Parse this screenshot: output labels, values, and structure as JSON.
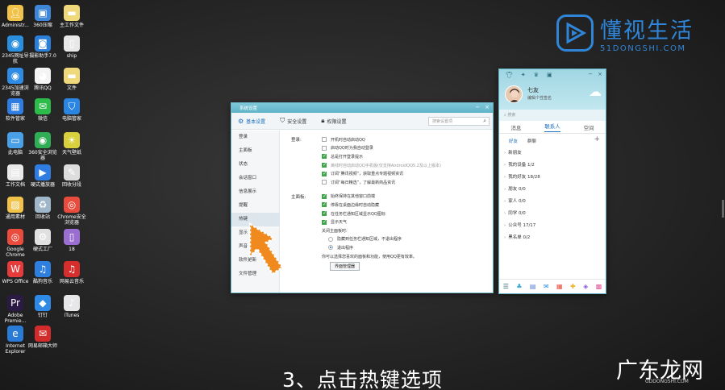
{
  "desktop_icons": [
    {
      "label": "Administr...",
      "icon": "user-folder-icon",
      "color": "#f0c24a"
    },
    {
      "label": "360压缩",
      "icon": "compress-icon",
      "color": "#3f86d9"
    },
    {
      "label": "主工作文件",
      "icon": "folder-icon",
      "color": "#f0d97a"
    },
    {
      "label": "2345网址导航",
      "icon": "browser-icon",
      "color": "#2b8fe0"
    },
    {
      "label": "摄影助手7.0",
      "icon": "camera-icon",
      "color": "#2c7fd8"
    },
    {
      "label": "ship",
      "icon": "file-icon",
      "color": "#e8e8e8"
    },
    {
      "label": "2345加速浏览器",
      "icon": "browser-icon",
      "color": "#2f8be3"
    },
    {
      "label": "腾讯QQ",
      "icon": "qq-icon",
      "color": "#f4f4f4"
    },
    {
      "label": "文件",
      "icon": "folder-icon",
      "color": "#f0d97a"
    },
    {
      "label": "软件管家",
      "icon": "app-store-icon",
      "color": "#2f7de0"
    },
    {
      "label": "微信",
      "icon": "wechat-icon",
      "color": "#2dbb4c"
    },
    {
      "label": "电脑管家",
      "icon": "shield-icon",
      "color": "#2a86e2"
    },
    {
      "label": "此电脑",
      "icon": "computer-icon",
      "color": "#4aa0e6"
    },
    {
      "label": "360安全浏览器",
      "icon": "browser-icon",
      "color": "#2fae56"
    },
    {
      "label": "天气壁纸",
      "icon": "weather-icon",
      "color": "#d8d03c"
    },
    {
      "label": "工作文档",
      "icon": "document-icon",
      "color": "#e9e9e9"
    },
    {
      "label": "硬式播放器",
      "icon": "player-icon",
      "color": "#2f7de0"
    },
    {
      "label": "回收分段",
      "icon": "tool-icon",
      "color": "#dddddd"
    },
    {
      "label": "通用素材",
      "icon": "image-icon",
      "color": "#f0c24a"
    },
    {
      "label": "回收站",
      "icon": "recycle-bin-icon",
      "color": "#9fb7c9"
    },
    {
      "label": "Chrome安全浏览器",
      "icon": "chrome-icon",
      "color": "#e94b3c"
    },
    {
      "label": "Google Chrome",
      "icon": "chrome-icon",
      "color": "#e94b3c"
    },
    {
      "label": "硬式工厂",
      "icon": "factory-icon",
      "color": "#e0e0e0"
    },
    {
      "label": "18",
      "icon": "file-icon",
      "color": "#9a6fd1"
    },
    {
      "label": "WPS Office",
      "icon": "wps-icon",
      "color": "#e53b3b"
    },
    {
      "label": "酷狗音乐",
      "icon": "music-icon",
      "color": "#2f80de"
    },
    {
      "label": "网易云音乐",
      "icon": "music-icon",
      "color": "#d62d2d"
    },
    {
      "label": "Adobe Premie...",
      "icon": "premiere-icon",
      "color": "#2a1a44"
    },
    {
      "label": "钉钉",
      "icon": "dingtalk-icon",
      "color": "#2f8ae6"
    },
    {
      "label": "iTunes",
      "icon": "itunes-icon",
      "color": "#e7e7ea"
    },
    {
      "label": "Internet Explorer",
      "icon": "ie-icon",
      "color": "#2a7bd6"
    },
    {
      "label": "网易邮箱大师",
      "icon": "mail-icon",
      "color": "#d22b2b"
    }
  ],
  "watermark": {
    "main": "懂视生活",
    "sub": "51DONGSHI.COM",
    "brand_color": "#2f86d8",
    "bottom_main": "广东龙网",
    "bottom_sub": "GDDONGSHI.COM"
  },
  "settings_window": {
    "title": "系统设置",
    "tabs": [
      {
        "label": "基本设置",
        "icon": "gear-icon",
        "active": true
      },
      {
        "label": "安全设置",
        "icon": "shield-icon",
        "active": false
      },
      {
        "label": "权限设置",
        "icon": "lock-icon",
        "active": false
      }
    ],
    "search_placeholder": "搜索设置项",
    "sidebar": [
      {
        "label": "登录"
      },
      {
        "label": "主面板"
      },
      {
        "label": "状态"
      },
      {
        "label": "会话窗口"
      },
      {
        "label": "信息展示"
      },
      {
        "label": "提醒"
      },
      {
        "label": "热键"
      },
      {
        "label": "显示"
      },
      {
        "label": "声音"
      },
      {
        "label": "软件更新"
      },
      {
        "label": "文件管理"
      }
    ],
    "login_section": {
      "label": "登录:",
      "options": [
        {
          "text": "开机时自动启动QQ",
          "checked": false,
          "dim": false
        },
        {
          "text": "启动QQ时为我自动登录",
          "checked": false,
          "dim": false
        },
        {
          "text": "总是打开登录提示",
          "checked": true,
          "dim": false
        },
        {
          "text": "离线时自动启动QQ手机版(仅支持AndroidQQ5.2及以上版本)",
          "checked": true,
          "dim": true
        },
        {
          "text": "订阅“腾讯视频”，获取重点专题视频资讯",
          "checked": true,
          "dim": false
        },
        {
          "text": "订阅“每日精选”，了解最新商品资讯",
          "checked": false,
          "dim": false
        }
      ]
    },
    "main_panel_section": {
      "label": "主面板:",
      "options": [
        {
          "text": "始终保持在其他窗口前端",
          "checked": true
        },
        {
          "text": "停靠在桌面边缘时自动隐藏",
          "checked": true
        },
        {
          "text": "在任务栏通知区域显示QQ图标",
          "checked": true
        },
        {
          "text": "显示天气",
          "checked": true
        }
      ],
      "close_label": "关闭主面板时:",
      "radios": [
        {
          "text": "隐藏到任务栏通知区域，不退出程序",
          "selected": false
        },
        {
          "text": "退出程序",
          "selected": true
        }
      ],
      "note": "你可以选择您喜欢的面板和功能，使用QQ更有效率。",
      "manager_button": "界面管理器"
    }
  },
  "qq_panel": {
    "nickname": "七友",
    "signature": "编辑个性签名",
    "search_placeholder": "搜索",
    "main_tabs": [
      {
        "label": "消息",
        "active": false
      },
      {
        "label": "联系人",
        "active": true
      },
      {
        "label": "空间",
        "active": false
      }
    ],
    "sub_tabs": [
      {
        "label": "好友",
        "active": true
      },
      {
        "label": "群聊",
        "active": false
      }
    ],
    "groups": [
      {
        "label": "新朋友"
      },
      {
        "label": "我的设备 1/2"
      },
      {
        "label": "我的好友 18/28"
      },
      {
        "label": "朋友 0/0"
      },
      {
        "label": "家人 0/0"
      },
      {
        "label": "同学 0/0"
      },
      {
        "label": "公众号 17/17"
      },
      {
        "label": "黑名单 0/2"
      }
    ]
  },
  "caption": "3、点击热键选项"
}
